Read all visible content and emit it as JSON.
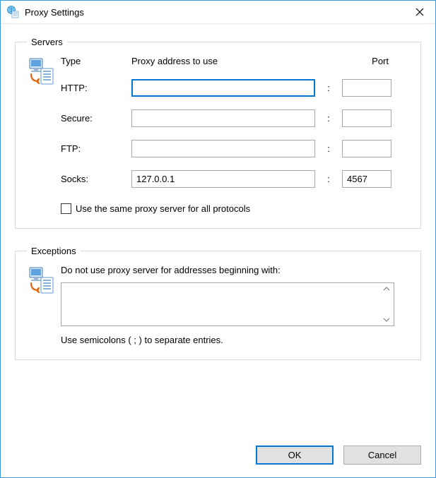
{
  "window": {
    "title": "Proxy Settings"
  },
  "servers": {
    "legend": "Servers",
    "header_type": "Type",
    "header_address": "Proxy address to use",
    "header_port": "Port",
    "rows": {
      "http": {
        "label": "HTTP:",
        "address": "",
        "port": ""
      },
      "secure": {
        "label": "Secure:",
        "address": "",
        "port": ""
      },
      "ftp": {
        "label": "FTP:",
        "address": "",
        "port": ""
      },
      "socks": {
        "label": "Socks:",
        "address": "127.0.0.1",
        "port": "4567"
      }
    },
    "same_for_all_label": "Use the same proxy server for all protocols",
    "same_for_all_checked": false
  },
  "exceptions": {
    "legend": "Exceptions",
    "description": "Do not use proxy server for addresses beginning with:",
    "value": "",
    "hint": "Use semicolons ( ; ) to separate entries."
  },
  "buttons": {
    "ok": "OK",
    "cancel": "Cancel"
  }
}
